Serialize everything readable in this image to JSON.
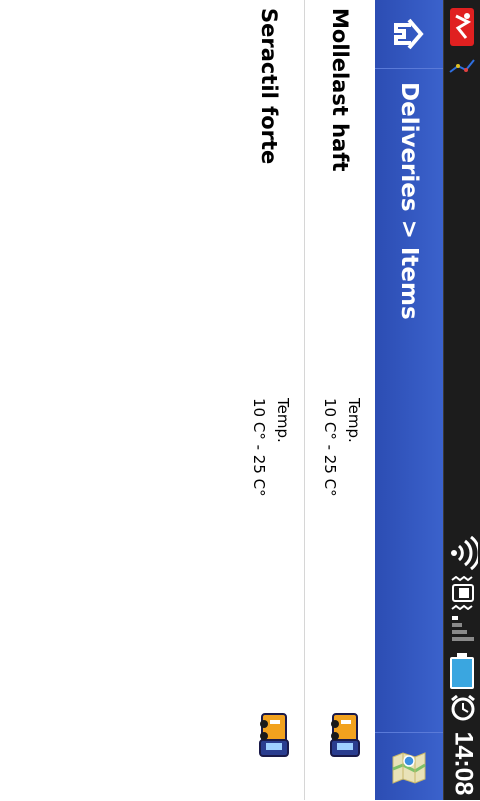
{
  "status_bar": {
    "time": "14:08",
    "icons": [
      "app-notification-icon",
      "satellite-icon",
      "wifi-icon",
      "vibrate-icon",
      "signal-icon",
      "battery-icon",
      "alarm-icon"
    ],
    "battery_color": "#3aa6e0"
  },
  "title_bar": {
    "title": "Deliveries > Items",
    "home_icon": "home-up-icon",
    "map_icon": "map-icon",
    "background": "#3558c4"
  },
  "items": [
    {
      "name": "Mollelast haft",
      "temp_label": "Temp.",
      "temp_range": "10 C° - 25 C°",
      "icon": "truck-icon"
    },
    {
      "name": "Seractil forte",
      "temp_label": "Temp.",
      "temp_range": "10 C° - 25 C°",
      "icon": "truck-icon"
    }
  ]
}
